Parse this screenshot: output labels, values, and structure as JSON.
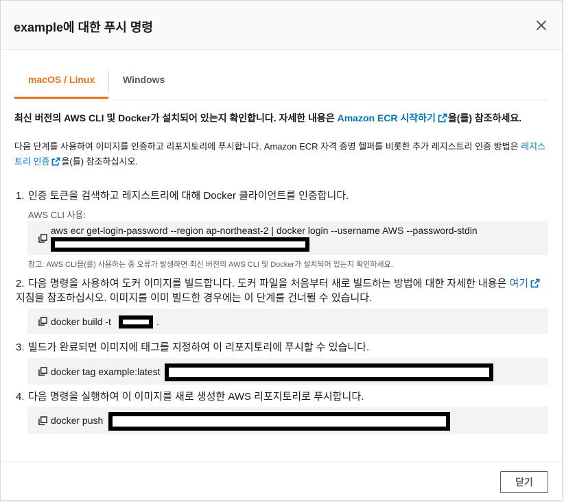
{
  "modal": {
    "title": "example에 대한 푸시 명령",
    "close_button": "닫기"
  },
  "tabs": [
    {
      "label": "macOS / Linux",
      "active": true
    },
    {
      "label": "Windows",
      "active": false
    }
  ],
  "intro": {
    "p1_before": "최신 버전의 AWS CLI 및 Docker가 설치되어 있는지 확인합니다. 자세한 내용은 ",
    "p1_link": "Amazon ECR 시작하기",
    "p1_after": "을(를) 참조하세요.",
    "p2_before": "다음 단계를 사용하여 이미지를 인증하고 리포지토리에 푸시합니다. Amazon ECR 자격 증명 헬퍼를 비롯한 추가 레지스트리 인증 방법은 ",
    "p2_link": "레지스트리 인증",
    "p2_after": "을(를) 참조하십시오."
  },
  "steps": [
    {
      "number": "1.",
      "text": "인증 토큰을 검색하고 레지스트리에 대해 Docker 클라이언트를 인증합니다.",
      "sublabel": "AWS CLI 사용:",
      "command": "aws ecr get-login-password --region ap-northeast-2 | docker login --username AWS --password-stdin",
      "note": "참고: AWS CLI을(를) 사용하는 중 오류가 발생하면 최신 버전의 AWS CLI 및 Docker가 설치되어 있는지 확인하세요."
    },
    {
      "number": "2.",
      "text_before": "다음 명령을 사용하여 도커 이미지를 빌드합니다. 도커 파일을 처음부터 새로 빌드하는 방법에 대한 자세한 내용은 ",
      "link": "여기",
      "text_after": " 지침을 참조하십시오. 이미지를 이미 빌드한 경우에는 이 단계를 건너뛸 수 있습니다.",
      "command": "docker build -t",
      "command_suffix": "."
    },
    {
      "number": "3.",
      "text": "빌드가 완료되면 이미지에 태그를 지정하여 이 리포지토리에 푸시할 수 있습니다.",
      "command": "docker tag example:latest"
    },
    {
      "number": "4.",
      "text": "다음 명령을 실행하여 이 이미지를 새로 생성한 AWS 리포지토리로 푸시합니다.",
      "command": "docker push"
    }
  ],
  "icons": {
    "close": "close-icon",
    "copy": "copy-icon",
    "external": "external-link-icon"
  },
  "colors": {
    "accent": "#ec7211",
    "link": "#0073bb",
    "code_bg": "#f2f3f3"
  }
}
